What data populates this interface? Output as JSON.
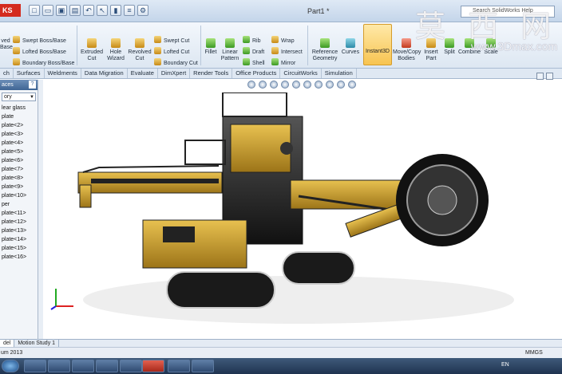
{
  "window": {
    "logo": "KS",
    "title": "Part1 *"
  },
  "search": {
    "placeholder": "Search SolidWorks Help"
  },
  "ribbon": {
    "extruded_boss": "ved\nBase",
    "swept_boss": "Swept Boss/Base",
    "lofted_boss": "Lofted Boss/Base",
    "boundary_boss": "Boundary Boss/Base",
    "extruded_cut": "Extruded\nCut",
    "hole_wizard": "Hole\nWizard",
    "revolved_cut": "Revolved\nCut",
    "swept_cut": "Swept Cut",
    "lofted_cut": "Lofted Cut",
    "boundary_cut": "Boundary Cut",
    "fillet": "Fillet",
    "linear_pattern": "Linear\nPattern",
    "rib": "Rib",
    "draft": "Draft",
    "shell": "Shell",
    "wrap": "Wrap",
    "intersect": "Intersect",
    "mirror": "Mirror",
    "reference_geometry": "Reference\nGeometry",
    "curves": "Curves",
    "instant3d": "Instant3D",
    "move_copy": "Move/Copy\nBodies",
    "insert_part": "Insert\nPart",
    "split": "Split",
    "combine": "Combine",
    "scale": "Scale"
  },
  "tabs": [
    "ch",
    "Surfaces",
    "Weldments",
    "Data Migration",
    "Evaluate",
    "DimXpert",
    "Render Tools",
    "Office Products",
    "CircuitWorks",
    "Simulation"
  ],
  "panel": {
    "header": "aces",
    "help": "?",
    "dropdown": "ory",
    "items": [
      "lear glass",
      "",
      "plate",
      "plate<2>",
      "plate<3>",
      "plate<4>",
      "",
      "plate<5>",
      "plate<6>",
      "plate<7>",
      "",
      "plate<8>",
      "plate<9>",
      "plate<10>",
      "per",
      "plate<11>",
      "plate<12>",
      "plate<13>",
      "plate<14>",
      "",
      "plate<15>",
      "plate<16>"
    ]
  },
  "bottom_tabs": [
    "del",
    "Motion Study 1"
  ],
  "status": {
    "left": "um 2013",
    "units": "MMGS"
  },
  "taskbar": {
    "lang": "EN",
    "time": "",
    "date": ""
  },
  "watermark": {
    "cn": "莫 西 网",
    "url": "www.3Dmax.com"
  }
}
